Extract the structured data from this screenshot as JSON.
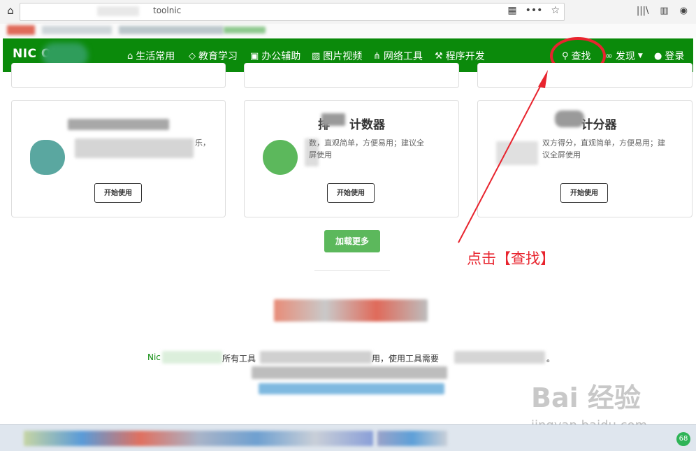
{
  "browser": {
    "url": "toolnic",
    "icons": [
      "home-icon",
      "qr-code-icon",
      "more-icon",
      "star-icon",
      "library-icon",
      "sidebar-icon",
      "account-icon"
    ]
  },
  "nav": {
    "logo": "NIC    OL+",
    "items": [
      {
        "label": "生活常用",
        "icon": "house-icon"
      },
      {
        "label": "教育学习",
        "icon": "graduation-cap-icon"
      },
      {
        "label": "办公辅助",
        "icon": "briefcase-icon"
      },
      {
        "label": "图片视频",
        "icon": "picture-icon"
      },
      {
        "label": "网络工具",
        "icon": "network-icon"
      },
      {
        "label": "程序开发",
        "icon": "wrench-icon"
      }
    ],
    "search": "查找",
    "discover": "发现",
    "login": "登录"
  },
  "cards": [
    {
      "title": "",
      "desc": "乐，",
      "desc2": "籍等。",
      "button": "开始使用"
    },
    {
      "title": "计数器",
      "title_prefix": "排",
      "desc": "数，直观简单，方便易用；建议全",
      "desc2": "屏使用",
      "button": "开始使用"
    },
    {
      "title": "计分器",
      "desc": "双方得分，直观简单，方便易用；建",
      "desc2": "议全屏使用",
      "button": "开始使用"
    }
  ],
  "load_more": "加载更多",
  "annotation": "点击【查找】",
  "footer": {
    "prefix": "Nic",
    "mid1": "所有工具",
    "mid2": "用，使用工具需要",
    "end": "。"
  },
  "taskbar": {
    "badge": "68"
  },
  "watermark": {
    "main": "Bai 经验",
    "sub": "jingyan.baidu.com"
  },
  "colors": {
    "nav_bg": "#0b8a0b",
    "accent_red": "#e8242e",
    "load_more_bg": "#5cb85c"
  }
}
